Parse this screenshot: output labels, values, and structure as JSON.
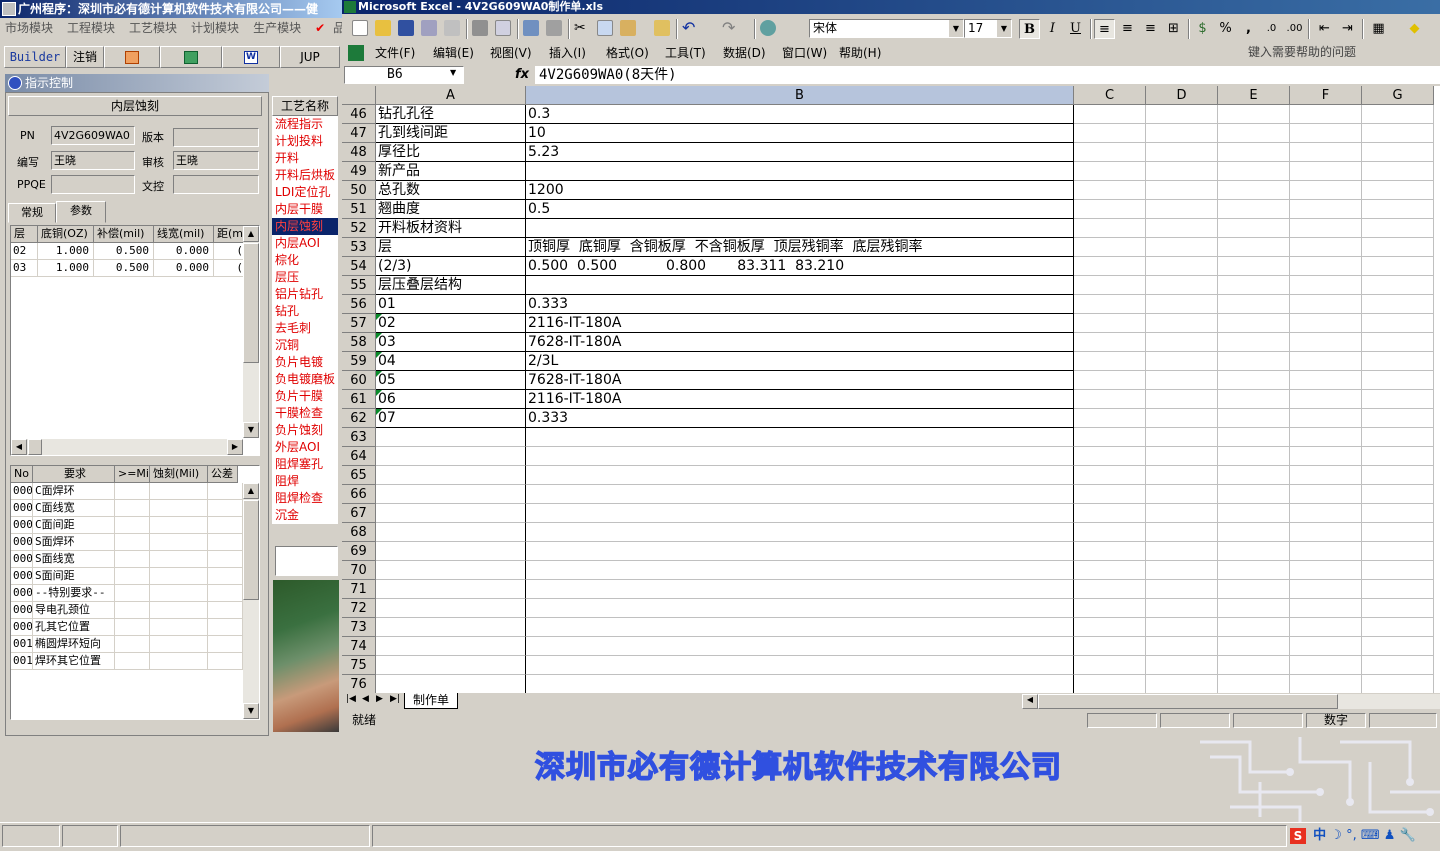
{
  "left_app": {
    "title": "广州程序：深圳市必有德计算机软件技术有限公司——健",
    "menu": [
      "市场模块",
      "工程模块",
      "工艺模块",
      "计划模块",
      "生产模块",
      "品"
    ],
    "toolbar": {
      "builder": "Builder",
      "logout": "注销",
      "jup": "JUP"
    },
    "control_title": "指示控制",
    "panel_title": "内层蚀刻",
    "fields": {
      "pn_label": "PN",
      "pn_value": "4V2G609WA0",
      "version_label": "版本",
      "version_value": "",
      "writer_label": "编写",
      "writer_value": "王晓",
      "reviewer_label": "审核",
      "reviewer_value": "王晓",
      "ppqe_label": "PPQE",
      "ppqe_value": "",
      "wenzhuan_label": "文控",
      "wenzhuan_value": ""
    },
    "tabs": [
      "常规",
      "参数"
    ],
    "param_grid": {
      "headers": [
        "层",
        "底铜(OZ)",
        "补偿(mil)",
        "线宽(mil)",
        "距(mi"
      ],
      "rows": [
        [
          "02",
          "1.000",
          "0.500",
          "0.000",
          "("
        ],
        [
          "03",
          "1.000",
          "0.500",
          "0.000",
          "("
        ]
      ]
    },
    "req_grid": {
      "headers": [
        "No",
        "要求",
        ">=Mil",
        "蚀刻(Mil)",
        "公差"
      ],
      "rows": [
        [
          "000",
          "C面焊环"
        ],
        [
          "000",
          "C面线宽"
        ],
        [
          "000",
          "C面间距"
        ],
        [
          "000",
          "S面焊环"
        ],
        [
          "000",
          "S面线宽"
        ],
        [
          "000",
          "S面间距"
        ],
        [
          "000",
          "--特别要求--"
        ],
        [
          "000",
          "导电孔颈位"
        ],
        [
          "000",
          "孔其它位置"
        ],
        [
          "001",
          "椭圆焊环短向"
        ],
        [
          "001",
          "焊环其它位置"
        ]
      ]
    },
    "process": {
      "header": "工艺名称",
      "items": [
        "流程指示",
        "计划投料",
        "开料",
        "开料后烘板",
        "LDI定位孔",
        "内层干膜",
        "内层蚀刻",
        "内层AOI",
        "棕化",
        "层压",
        "铝片钻孔",
        "钻孔",
        "去毛刺",
        "沉铜",
        "负片电镀",
        "负电镀磨板",
        "负片干膜",
        "干膜检查",
        "负片蚀刻",
        "外层AOI",
        "阻焊塞孔",
        "阻焊",
        "阻焊检查",
        "沉金"
      ],
      "selected_index": 6
    }
  },
  "excel": {
    "title": "Microsoft Excel - 4V2G609WA0制作单.xls",
    "font_name": "宋体",
    "font_size": "17",
    "menu": [
      "文件(F)",
      "编辑(E)",
      "视图(V)",
      "插入(I)",
      "格式(O)",
      "工具(T)",
      "数据(D)",
      "窗口(W)",
      "帮助(H)"
    ],
    "help_placeholder": "键入需要帮助的问题",
    "name_box": "B6",
    "fx_label": "fx",
    "formula": "4V2G609WA0(8天件)",
    "columns": [
      "A",
      "B",
      "C",
      "D",
      "E",
      "F",
      "G"
    ],
    "selected_column": "B",
    "rows": [
      {
        "n": "46",
        "a": "钻孔孔径",
        "b": "0.3"
      },
      {
        "n": "47",
        "a": "孔到线间距",
        "b": "10"
      },
      {
        "n": "48",
        "a": "厚径比",
        "b": "5.23"
      },
      {
        "n": "49",
        "a": "新产品",
        "b": ""
      },
      {
        "n": "50",
        "a": "总孔数",
        "b": "1200"
      },
      {
        "n": "51",
        "a": "翘曲度",
        "b": "0.5"
      },
      {
        "n": "52",
        "a": "开料板材资料",
        "b": ""
      },
      {
        "n": "53",
        "a": "层",
        "b": "顶铜厚  底铜厚  含铜板厚  不含铜板厚  顶层残铜率  底层残铜率"
      },
      {
        "n": "54",
        "a": "(2/3)",
        "b": "0.500  0.500           0.800       83.311  83.210"
      },
      {
        "n": "55",
        "a": "层压叠层结构",
        "b": ""
      },
      {
        "n": "56",
        "a": "01",
        "b": "0.333"
      },
      {
        "n": "57",
        "a": "02",
        "b": "2116-IT-180A",
        "tri": true
      },
      {
        "n": "58",
        "a": "03",
        "b": "7628-IT-180A",
        "tri": true
      },
      {
        "n": "59",
        "a": "04",
        "b": "2/3L",
        "tri": true
      },
      {
        "n": "60",
        "a": "05",
        "b": "7628-IT-180A",
        "tri": true
      },
      {
        "n": "61",
        "a": "06",
        "b": "2116-IT-180A",
        "tri": true
      },
      {
        "n": "62",
        "a": "07",
        "b": "0.333",
        "tri": true
      },
      {
        "n": "63",
        "a": "",
        "b": ""
      },
      {
        "n": "64",
        "a": "",
        "b": ""
      },
      {
        "n": "65",
        "a": "",
        "b": ""
      },
      {
        "n": "66",
        "a": "",
        "b": ""
      },
      {
        "n": "67",
        "a": "",
        "b": ""
      },
      {
        "n": "68",
        "a": "",
        "b": ""
      },
      {
        "n": "69",
        "a": "",
        "b": ""
      },
      {
        "n": "70",
        "a": "",
        "b": ""
      },
      {
        "n": "71",
        "a": "",
        "b": ""
      },
      {
        "n": "72",
        "a": "",
        "b": ""
      },
      {
        "n": "73",
        "a": "",
        "b": ""
      },
      {
        "n": "74",
        "a": "",
        "b": ""
      },
      {
        "n": "75",
        "a": "",
        "b": ""
      },
      {
        "n": "76",
        "a": "",
        "b": ""
      }
    ],
    "sheet_tab": "制作单",
    "status_left": "就绪",
    "status_right": "数字"
  },
  "company_banner": "深圳市必有德计算机软件技术有限公司",
  "ime": {
    "logo": "S",
    "lang": "中",
    "items": [
      "moon-icon",
      "comma-icon",
      "keyboard-icon",
      "user-icon",
      "wrench-icon"
    ]
  }
}
